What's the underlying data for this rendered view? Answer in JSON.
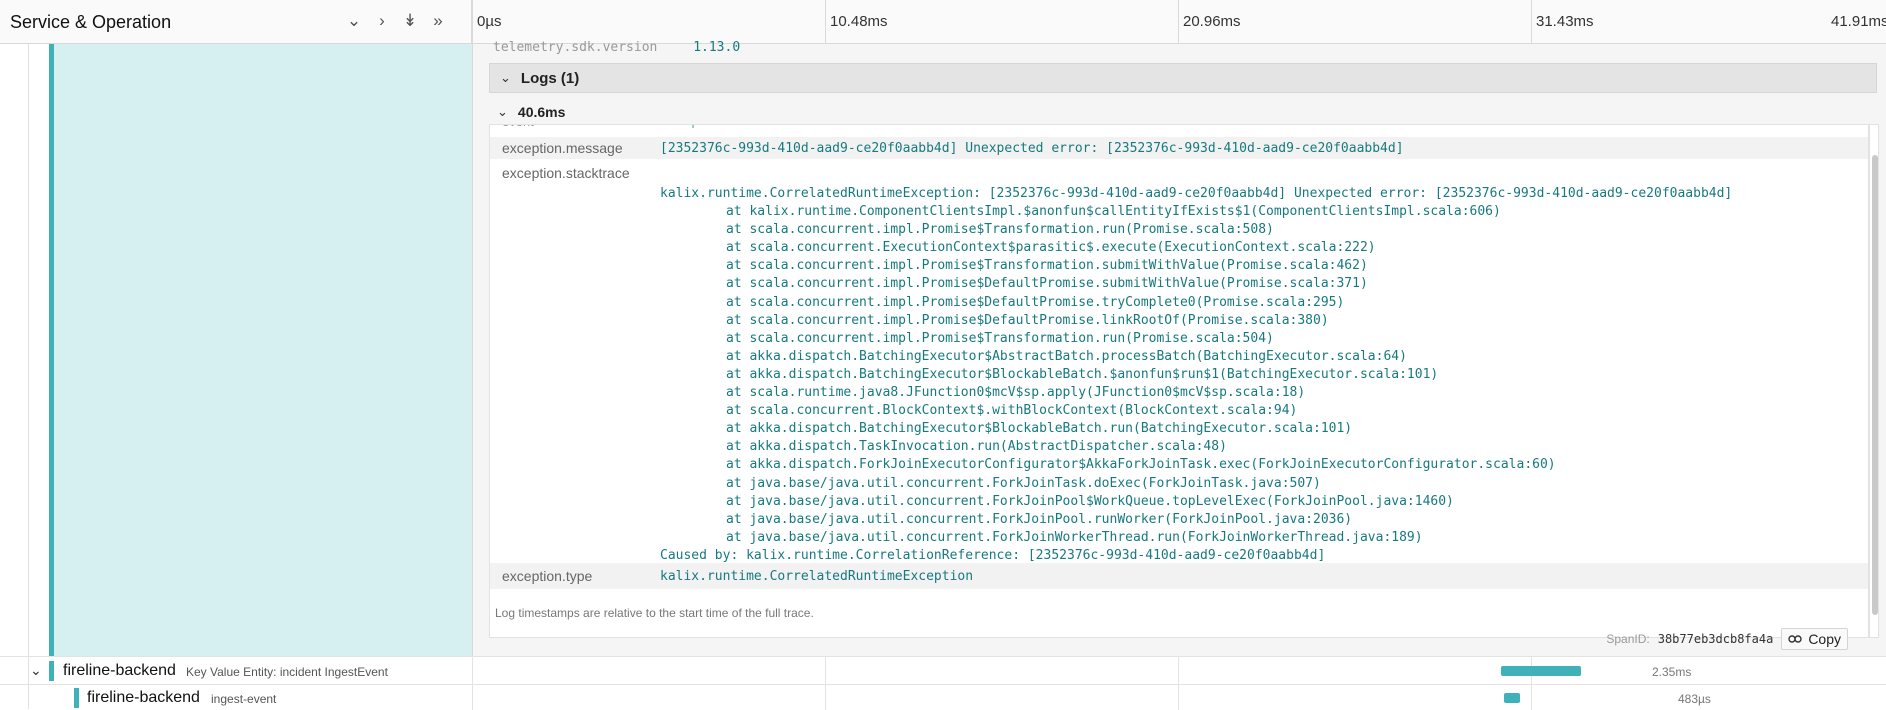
{
  "header": {
    "title": "Service & Operation",
    "ticks": [
      "0µs",
      "10.48ms",
      "20.96ms",
      "31.43ms",
      "41.91ms"
    ]
  },
  "panel": {
    "cut_row": {
      "key": "telemetry.sdk.version",
      "value": "1.13.0"
    },
    "logs_header": "Logs (1)",
    "log_time": "40.6ms",
    "cut_event": {
      "key": "event",
      "value": "exception"
    },
    "message": {
      "key": "exception.message",
      "value": "[2352376c-993d-410d-aad9-ce20f0aabb4d] Unexpected error: [2352376c-993d-410d-aad9-ce20f0aabb4d]"
    },
    "stacktrace_key": "exception.stacktrace",
    "stacktrace_first": "kalix.runtime.CorrelatedRuntimeException: [2352376c-993d-410d-aad9-ce20f0aabb4d] Unexpected error: [2352376c-993d-410d-aad9-ce20f0aabb4d]",
    "stacktrace_lines": [
      "at kalix.runtime.ComponentClientsImpl.$anonfun$callEntityIfExists$1(ComponentClientsImpl.scala:606)",
      "at scala.concurrent.impl.Promise$Transformation.run(Promise.scala:508)",
      "at scala.concurrent.ExecutionContext$parasitic$.execute(ExecutionContext.scala:222)",
      "at scala.concurrent.impl.Promise$Transformation.submitWithValue(Promise.scala:462)",
      "at scala.concurrent.impl.Promise$DefaultPromise.submitWithValue(Promise.scala:371)",
      "at scala.concurrent.impl.Promise$DefaultPromise.tryComplete0(Promise.scala:295)",
      "at scala.concurrent.impl.Promise$DefaultPromise.linkRootOf(Promise.scala:380)",
      "at scala.concurrent.impl.Promise$Transformation.run(Promise.scala:504)",
      "at akka.dispatch.BatchingExecutor$AbstractBatch.processBatch(BatchingExecutor.scala:64)",
      "at akka.dispatch.BatchingExecutor$BlockableBatch.$anonfun$run$1(BatchingExecutor.scala:101)",
      "at scala.runtime.java8.JFunction0$mcV$sp.apply(JFunction0$mcV$sp.scala:18)",
      "at scala.concurrent.BlockContext$.withBlockContext(BlockContext.scala:94)",
      "at akka.dispatch.BatchingExecutor$BlockableBatch.run(BatchingExecutor.scala:101)",
      "at akka.dispatch.TaskInvocation.run(AbstractDispatcher.scala:48)",
      "at akka.dispatch.ForkJoinExecutorConfigurator$AkkaForkJoinTask.exec(ForkJoinExecutorConfigurator.scala:60)",
      "at java.base/java.util.concurrent.ForkJoinTask.doExec(ForkJoinTask.java:507)",
      "at java.base/java.util.concurrent.ForkJoinPool$WorkQueue.topLevelExec(ForkJoinPool.java:1460)",
      "at java.base/java.util.concurrent.ForkJoinPool.runWorker(ForkJoinPool.java:2036)",
      "at java.base/java.util.concurrent.ForkJoinWorkerThread.run(ForkJoinWorkerThread.java:189)"
    ],
    "stacktrace_caused": "Caused by: kalix.runtime.CorrelationReference: [2352376c-993d-410d-aad9-ce20f0aabb4d]",
    "type": {
      "key": "exception.type",
      "value": "kalix.runtime.CorrelatedRuntimeException"
    },
    "note": "Log timestamps are relative to the start time of the full trace.",
    "span_id_label": "SpanID:",
    "span_id": "38b77eb3dcb8fa4a",
    "copy_label": "Copy"
  },
  "rows": [
    {
      "service": "fireline-backend",
      "operation": "Key Value Entity: incident IngestEvent",
      "duration": "2.35ms",
      "bar_start_pct": 0.728,
      "bar_width_pct": 0.056
    },
    {
      "service": "fireline-backend",
      "operation": "ingest-event",
      "duration": "483µs",
      "bar_start_pct": 0.7295,
      "bar_width_pct": 0.012
    }
  ],
  "colors": {
    "accent": "#3fb2b9",
    "value_text": "#17797f",
    "span_bg": "#d6eff1"
  }
}
